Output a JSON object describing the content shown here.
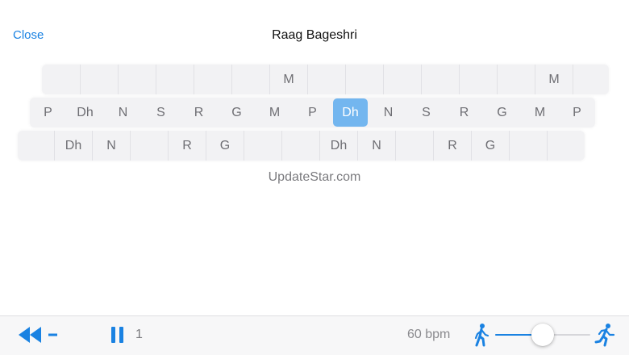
{
  "header": {
    "close_label": "Close",
    "title": "Raag Bageshri"
  },
  "notation": {
    "row1": [
      "",
      "",
      "",
      "",
      "",
      "",
      "M",
      "",
      "",
      "",
      "",
      "",
      "",
      "M",
      ""
    ],
    "row2": [
      "P",
      "Dh",
      "N",
      "S",
      "R",
      "G",
      "M",
      "P",
      "Dh",
      "N",
      "S",
      "R",
      "G",
      "M",
      "P"
    ],
    "row3": [
      "",
      "Dh",
      "N",
      "",
      "R",
      "G",
      "",
      "",
      "Dh",
      "N",
      "",
      "R",
      "G",
      "",
      ""
    ],
    "active_row": 2,
    "active_index": 8,
    "active_color": "#73b6ef"
  },
  "watermark": "UpdateStar.com",
  "player": {
    "beat_count": "1",
    "tempo": "60 bpm",
    "tempo_level": 0.5,
    "rewind_icon": "rewind-icon",
    "pause_icon": "pause-icon",
    "slow_icon": "walking-person-icon",
    "fast_icon": "running-person-icon",
    "accent_color": "#1a82e2"
  }
}
